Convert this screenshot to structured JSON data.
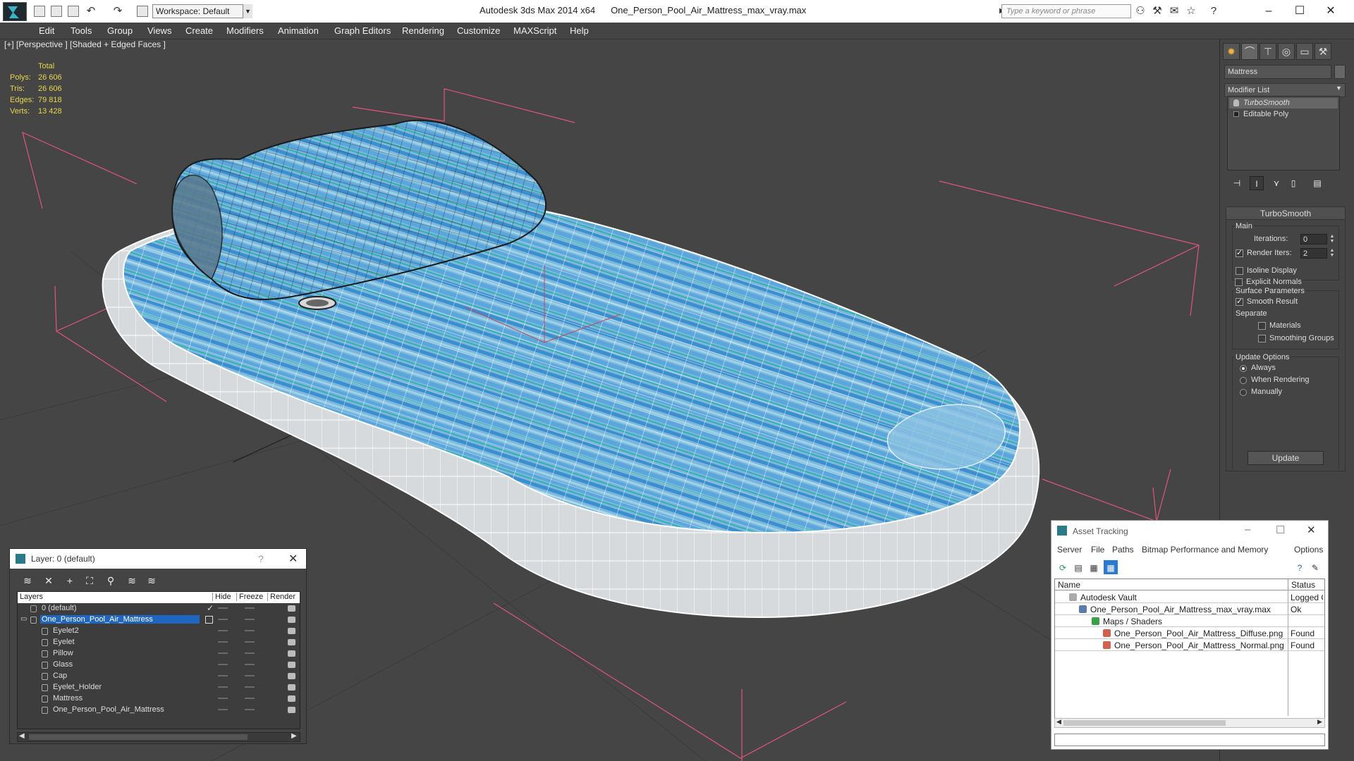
{
  "titlebar": {
    "workspace": "Workspace: Default",
    "app": "Autodesk 3ds Max  2014 x64",
    "file": "One_Person_Pool_Air_Mattress_max_vray.max",
    "search_placeholder": "Type a keyword or phrase"
  },
  "menu": [
    "Edit",
    "Tools",
    "Group",
    "Views",
    "Create",
    "Modifiers",
    "Animation",
    "Graph Editors",
    "Rendering",
    "Customize",
    "MAXScript",
    "Help"
  ],
  "viewport": {
    "label": "[+] [Perspective ] [Shaded + Edged Faces ]",
    "stats": {
      "header": "Total",
      "polys_label": "Polys:",
      "polys": "26 606",
      "tris_label": "Tris:",
      "tris": "26 606",
      "edges_label": "Edges:",
      "edges": "79 818",
      "verts_label": "Verts:",
      "verts": "13 428"
    }
  },
  "command_panel": {
    "object_name": "Mattress",
    "modifier_list": "Modifier List",
    "stack": [
      "TurboSmooth",
      "Editable Poly"
    ],
    "turbosmooth": {
      "title": "TurboSmooth",
      "main": "Main",
      "iterations_label": "Iterations:",
      "iterations": "0",
      "render_iters_label": "Render Iters:",
      "render_iters": "2",
      "isoline": "Isoline Display",
      "explicit": "Explicit Normals",
      "surface": "Surface Parameters",
      "smooth_result": "Smooth Result",
      "separate": "Separate",
      "materials": "Materials",
      "smoothing_groups": "Smoothing Groups",
      "update_options": "Update Options",
      "always": "Always",
      "when_rendering": "When Rendering",
      "manually": "Manually",
      "update_button": "Update"
    }
  },
  "layer_window": {
    "title": "Layer: 0 (default)",
    "help": "?",
    "columns": [
      "Layers",
      "Hide",
      "Freeze",
      "Render"
    ],
    "rows": [
      "0 (default)",
      "One_Person_Pool_Air_Mattress",
      "Eyelet2",
      "Eyelet",
      "Pillow",
      "Glass",
      "Cap",
      "Eyelet_Holder",
      "Mattress",
      "One_Person_Pool_Air_Mattress"
    ]
  },
  "asset_window": {
    "title": "Asset Tracking",
    "menu": [
      "Server",
      "File",
      "Paths",
      "Bitmap Performance and Memory",
      "Options"
    ],
    "columns": [
      "Name",
      "Status"
    ],
    "rows": [
      {
        "name": "Autodesk Vault",
        "status": "Logged Out"
      },
      {
        "name": "One_Person_Pool_Air_Mattress_max_vray.max",
        "status": "Ok"
      },
      {
        "name": "Maps / Shaders",
        "status": ""
      },
      {
        "name": "One_Person_Pool_Air_Mattress_Diffuse.png",
        "status": "Found"
      },
      {
        "name": "One_Person_Pool_Air_Mattress_Normal.png",
        "status": "Found"
      }
    ]
  },
  "colors": {
    "stats_yellow": "#e8d64a",
    "selection_blue": "#1f66c0",
    "bbox_pink": "#e0557a",
    "mattress_blue": "#4aa3e0"
  }
}
